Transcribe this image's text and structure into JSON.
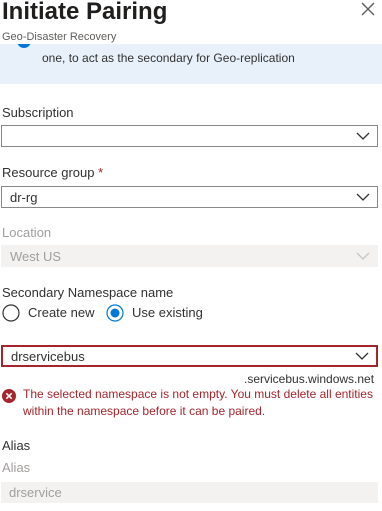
{
  "header": {
    "title": "Initiate Pairing",
    "subtitle": "Geo-Disaster Recovery"
  },
  "info": {
    "text": "one, to act as the secondary for Geo-replication"
  },
  "form": {
    "subscription": {
      "label": "Subscription",
      "value": ""
    },
    "resource_group": {
      "label": "Resource group",
      "required_mark": "*",
      "value": "dr-rg"
    },
    "location": {
      "label": "Location",
      "value": "West US"
    },
    "secondary_namespace": {
      "label": "Secondary Namespace name",
      "option_create": "Create new",
      "option_existing": "Use existing",
      "selected": "Use existing",
      "value": "drservicebus",
      "suffix": ".servicebus.windows.net",
      "error": "The selected namespace is not empty. You must delete all entities within the namespace before it can be paired."
    },
    "alias": {
      "section_label": "Alias",
      "field_label": "Alias",
      "value": "drservice"
    }
  },
  "colors": {
    "accent": "#0078d4",
    "error": "#a4262c",
    "info_bg": "#e8f1fa",
    "disabled_bg": "#f3f2f1"
  },
  "icons": [
    "close-icon",
    "info-icon",
    "chevron-down-icon",
    "error-icon"
  ]
}
